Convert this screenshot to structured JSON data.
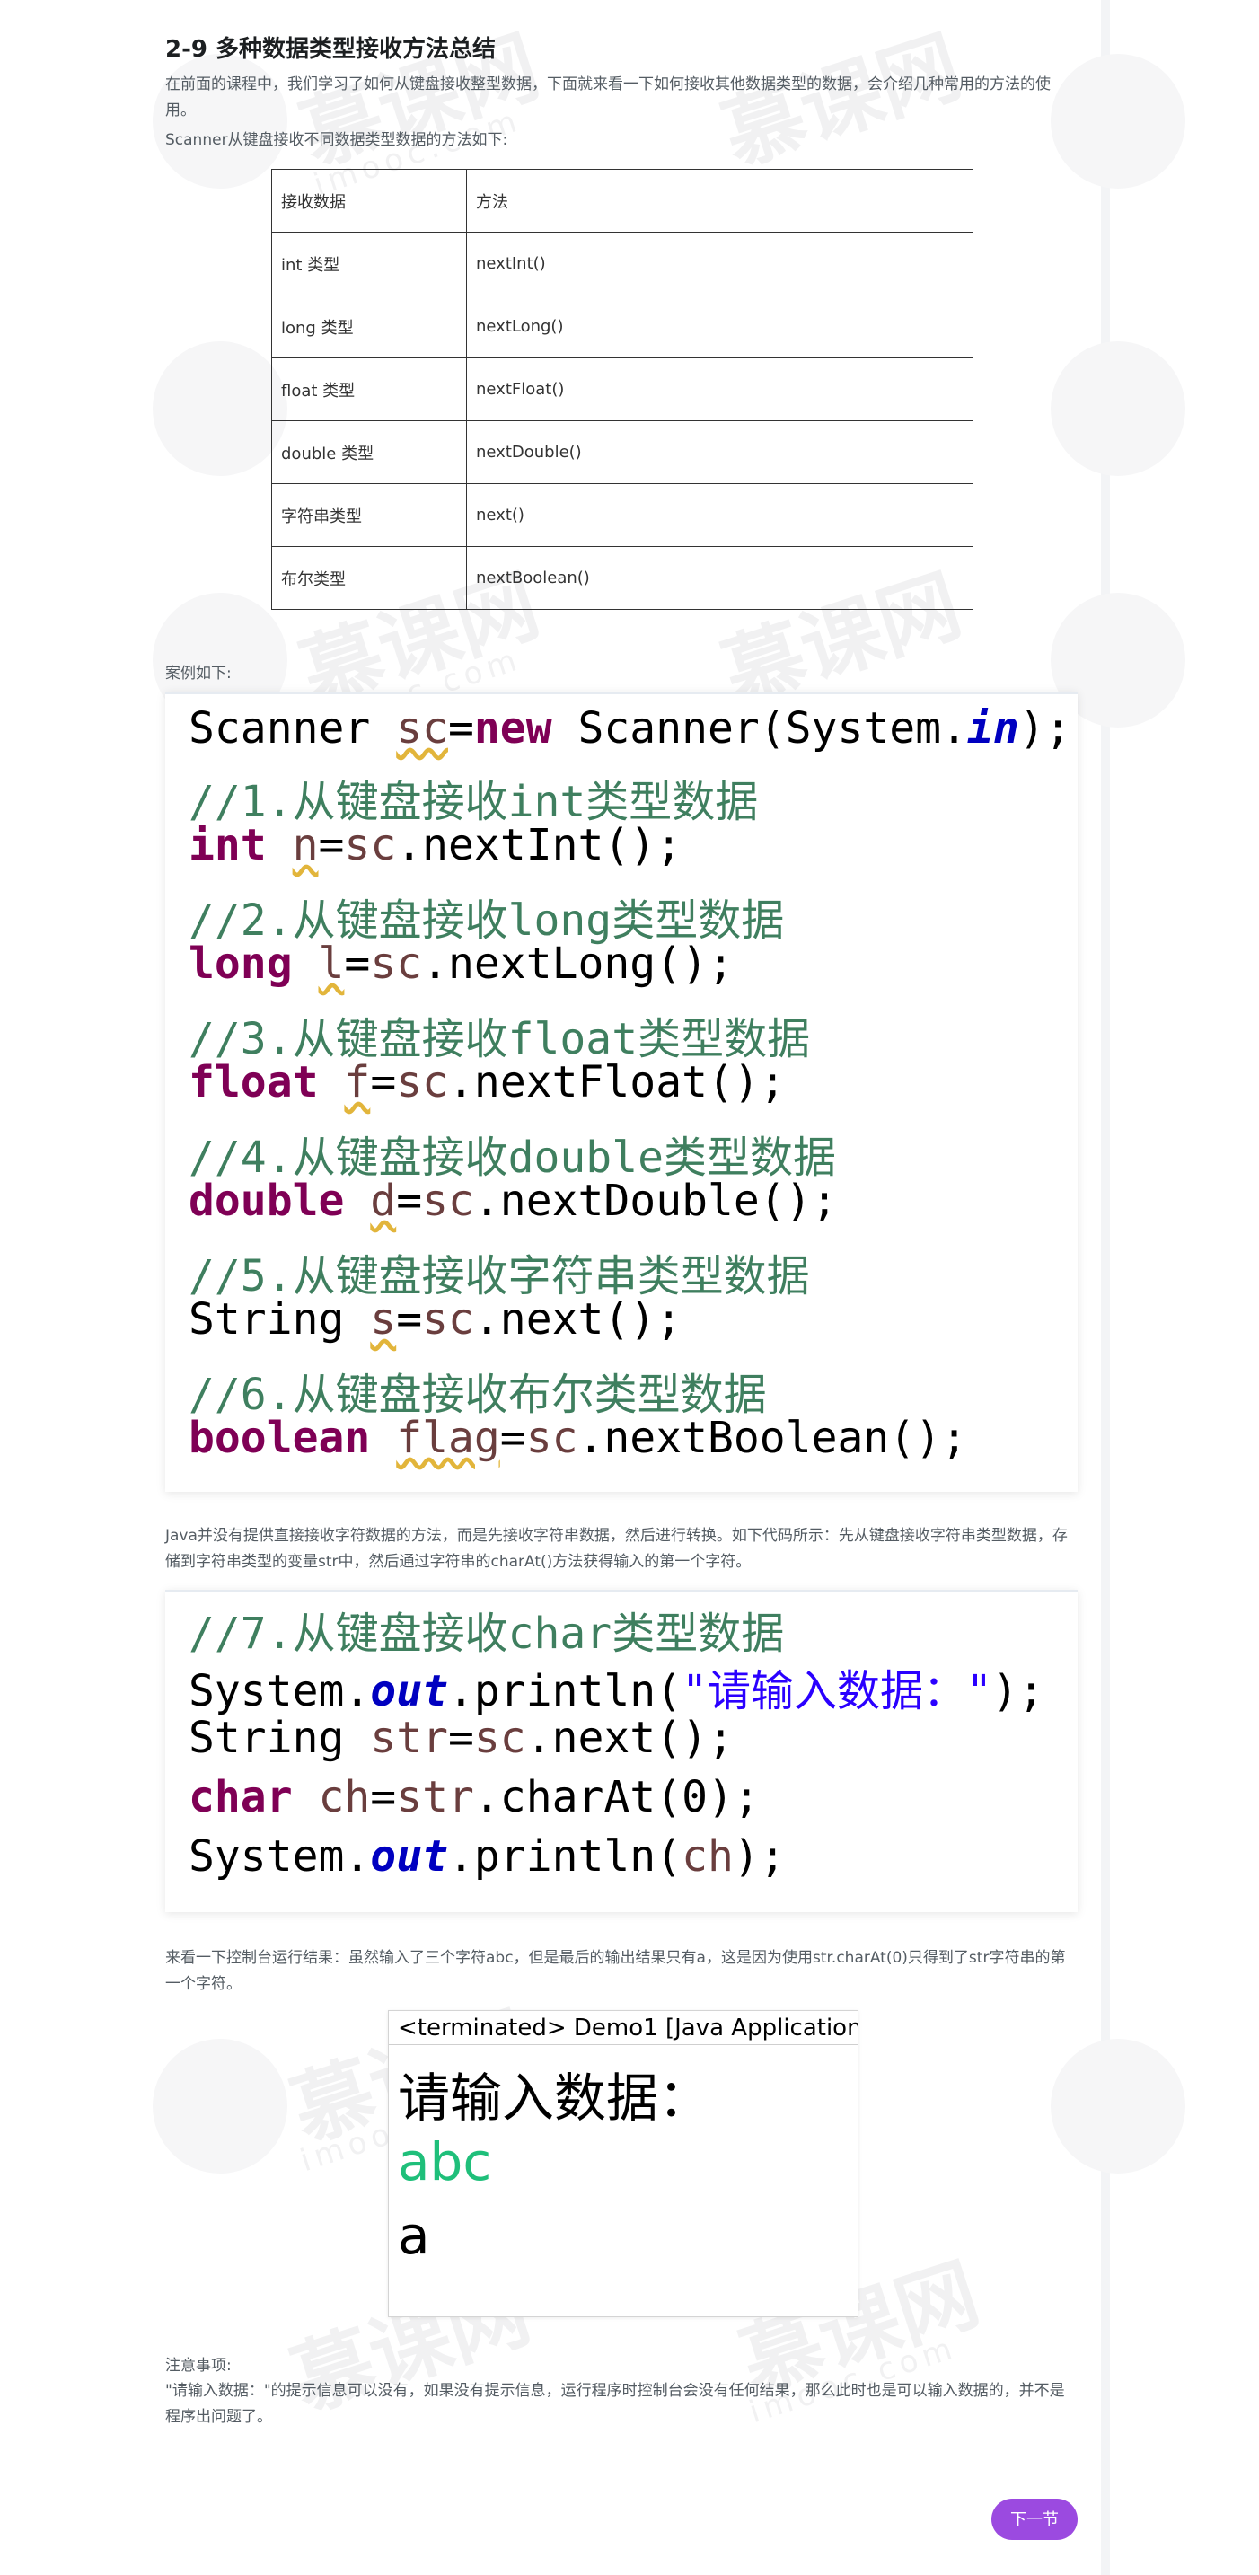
{
  "lesson": {
    "title": "2-9 多种数据类型接收方法总结",
    "intro": "在前面的课程中，我们学习了如何从键盘接收整型数据，下面就来看一下如何接收其他数据类型的数据，会介绍几种常用的方法的使用。",
    "table_caption": "Scanner从键盘接收不同数据类型数据的方法如下:",
    "table_headers": [
      "接收数据",
      "方法"
    ],
    "table_rows": [
      [
        "int 类型",
        "nextInt()"
      ],
      [
        "long 类型",
        "nextLong()"
      ],
      [
        "float 类型",
        "nextFloat()"
      ],
      [
        "double 类型",
        "nextDouble()"
      ],
      [
        "字符串类型",
        "next()"
      ],
      [
        "布尔类型",
        "nextBoolean()"
      ]
    ],
    "example_caption": "案例如下:",
    "char_explain": "Java并没有提供直接接收字符数据的方法，而是先接收字符串数据，然后进行转换。如下代码所示：先从键盘接收字符串类型数据，存储到字符串类型的变量str中，然后通过字符串的charAt()方法获得输入的第一个字符。",
    "result_explain": "来看一下控制台运行结果：虽然输入了三个字符abc，但是最后的输出结果只有a，这是因为使用str.charAt(0)只得到了str字符串的第一个字符。",
    "note_title": "注意事项:",
    "note_body": "\"请输入数据：\"的提示信息可以没有，如果没有提示信息，运行程序时控制台会没有任何结果，那么此时也是可以输入数据的，并不是程序出问题了。"
  },
  "code1": {
    "l1": [
      "Scanner ",
      "sc",
      "=",
      "new",
      " Scanner(System.",
      "in",
      ");"
    ],
    "l2": "//1.从键盘接收int类型数据",
    "l3": [
      "int",
      " ",
      "n",
      "=",
      "sc",
      ".nextInt();"
    ],
    "l4": "//2.从键盘接收long类型数据",
    "l5": [
      "long",
      " ",
      "l",
      "=",
      "sc",
      ".nextLong();"
    ],
    "l6": "//3.从键盘接收float类型数据",
    "l7": [
      "float",
      " ",
      "f",
      "=",
      "sc",
      ".nextFloat();"
    ],
    "l8": "//4.从键盘接收double类型数据",
    "l9": [
      "double",
      " ",
      "d",
      "=",
      "sc",
      ".nextDouble();"
    ],
    "l10": "//5.从键盘接收字符串类型数据",
    "l11": [
      "String ",
      "s",
      "=",
      "sc",
      ".next();"
    ],
    "l12": "//6.从键盘接收布尔类型数据",
    "l13": [
      "boolean",
      " ",
      "flag",
      "=",
      "sc",
      ".nextBoolean();"
    ]
  },
  "code2": {
    "l1": "//7.从键盘接收char类型数据",
    "l2": [
      "System.",
      "out",
      ".println(",
      "\"请输入数据：\"",
      ");"
    ],
    "l3": [
      "String ",
      "str",
      "=",
      "sc",
      ".next();"
    ],
    "l4": [
      "char",
      " ",
      "ch",
      "=",
      "str",
      ".charAt(0);"
    ],
    "l5": [
      "System.",
      "out",
      ".println(",
      "ch",
      ");"
    ]
  },
  "console": {
    "header": "<terminated> Demo1 [Java Application",
    "prompt": "请输入数据：",
    "input": "abc",
    "output": "a",
    "input_color": "#1fbf7a"
  },
  "nav": {
    "next_label": "下一节",
    "accent": "#9b4ae0"
  },
  "watermark": {
    "brand": "慕课网",
    "domain": "imooc.com"
  }
}
